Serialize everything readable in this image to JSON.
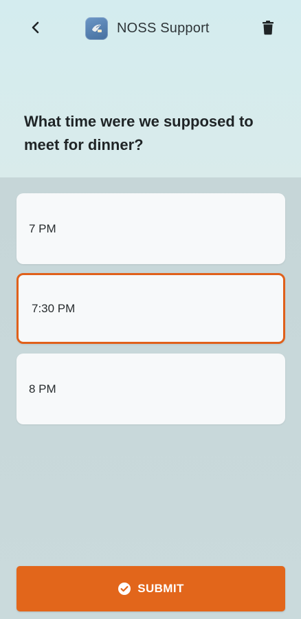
{
  "header": {
    "title": "NOSS Support",
    "back_icon": "chevron-left-icon",
    "app_icon": "noss-app-icon",
    "delete_icon": "trash-icon"
  },
  "question": "What time were we supposed to meet for dinner?",
  "options": [
    {
      "label": "7 PM",
      "selected": false
    },
    {
      "label": "7:30 PM",
      "selected": true
    },
    {
      "label": "8 PM",
      "selected": false
    }
  ],
  "submit": {
    "label": "SUBMIT",
    "icon": "check-circle-icon"
  },
  "colors": {
    "accent": "#e2661b",
    "header_bg": "#d4ecef",
    "body_bg": "#c8d8da",
    "card_bg": "#f7f9fa"
  }
}
